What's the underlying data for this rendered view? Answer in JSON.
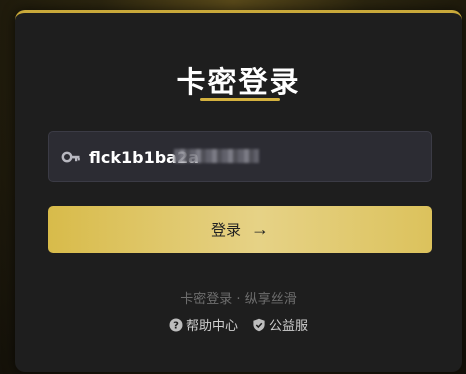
{
  "page": {
    "title": "卡密登录"
  },
  "form": {
    "key_value": "flck1b1ba2a",
    "key_icon": "key-icon",
    "login_label": "登录",
    "login_arrow": "→"
  },
  "footer": {
    "slogan": "卡密登录 · 纵享丝滑",
    "links": [
      {
        "label": "帮助中心",
        "icon": "question-circle-icon"
      },
      {
        "label": "公益服",
        "icon": "shield-icon"
      }
    ]
  },
  "colors": {
    "accent": "#d4b13f",
    "card_bg": "#1e1e1e",
    "button_gradient_start": "#d8bb4a",
    "button_gradient_end": "#e6d286"
  }
}
